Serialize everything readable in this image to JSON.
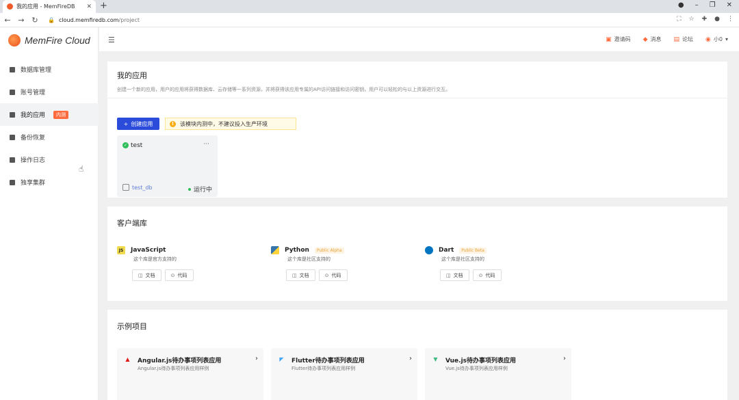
{
  "browser": {
    "tab_title": "我的应用 - MemFireDB",
    "url_host": "cloud.memfiredb.com",
    "url_path": "/project"
  },
  "sidebar": {
    "logo_text": "MemFire Cloud",
    "items": [
      {
        "label": "数据库管理",
        "icon": "database-icon"
      },
      {
        "label": "账号管理",
        "icon": "account-icon"
      },
      {
        "label": "我的应用",
        "icon": "app-icon",
        "badge": "内测",
        "active": true
      },
      {
        "label": "备份恢复",
        "icon": "backup-icon"
      },
      {
        "label": "操作日志",
        "icon": "log-icon"
      },
      {
        "label": "独享集群",
        "icon": "cluster-icon"
      }
    ]
  },
  "topbar": {
    "invite": "邀请码",
    "messages": "消息",
    "forum": "论坛",
    "user": "小0"
  },
  "apps": {
    "title": "我的应用",
    "description": "创建一个新的应用，用户的应用将获得数据库、云存储等一系列资源，并将获得该应用专属的API访问链接和访问密钥，用户可以轻松的与以上资源进行交互。",
    "create_button": "创建应用",
    "notice": "该模块内测中，不建议投入生产环境",
    "project": {
      "name": "test",
      "more": "···",
      "db": "test_db",
      "status": "运行中"
    }
  },
  "clients": {
    "title": "客户端库",
    "items": [
      {
        "name": "JavaScript",
        "tag": "",
        "desc": "这个库是官方支持的",
        "doc": "文档",
        "code": "代码",
        "color": "#f0db4f"
      },
      {
        "name": "Python",
        "tag": "Public Alpha",
        "desc": "这个库是社区支持的",
        "doc": "文档",
        "code": "代码",
        "color": "#3776ab"
      },
      {
        "name": "Dart",
        "tag": "Public Beta",
        "desc": "这个库是社区支持的",
        "doc": "文档",
        "code": "代码",
        "color": "#0175c2"
      }
    ]
  },
  "examples": {
    "title": "示例项目",
    "items": [
      {
        "title": "Angular.js待办事项列表应用",
        "desc": "Angular.js待办事项列表应用样例",
        "color": "#dd1b16"
      },
      {
        "title": "Flutter待办事项列表应用",
        "desc": "Flutter待办事项列表应用样例",
        "color": "#42a5f5"
      },
      {
        "title": "Vue.js待办事项列表应用",
        "desc": "Vue.js待办事项列表应用样例",
        "color": "#41b883"
      }
    ]
  }
}
